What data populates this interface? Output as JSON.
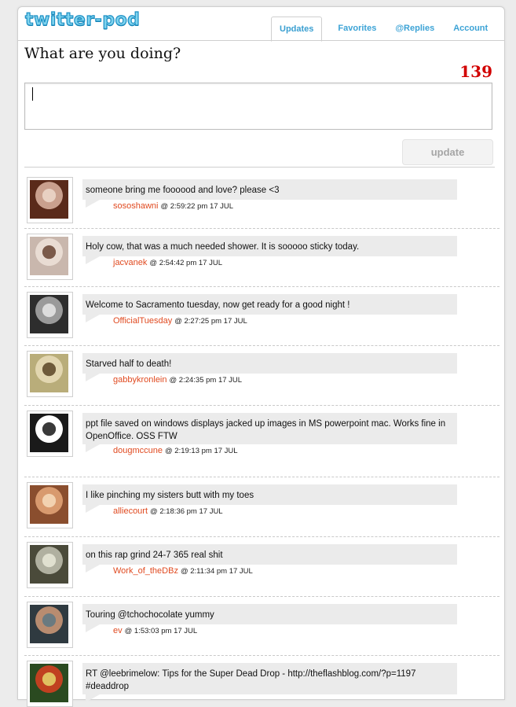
{
  "app": {
    "logo": "twitter-pod"
  },
  "tabs": [
    {
      "label": "Updates",
      "active": true
    },
    {
      "label": "Favorites",
      "active": false
    },
    {
      "label": "@Replies",
      "active": false
    },
    {
      "label": "Account",
      "active": false
    }
  ],
  "composer": {
    "prompt": "What are you doing?",
    "remaining": "139",
    "value": "",
    "update_label": "update"
  },
  "colors": {
    "accent": "#3ca3d6",
    "counter": "#d20000",
    "username": "#e04a20"
  },
  "tweets": [
    {
      "text": "someone bring me foooood and love? please <3",
      "user": "sososhawni",
      "time": "@ 2:59:22 pm 17 JUL",
      "avatar": "user-photo"
    },
    {
      "text": "Holy cow, that was a much needed shower. It is sooooo sticky today.",
      "user": "jacvanek",
      "time": "@ 2:54:42 pm 17 JUL",
      "avatar": "user-photo"
    },
    {
      "text": "Welcome to Sacramento tuesday, now get ready for a good night !",
      "user": "OfficialTuesday",
      "time": "@ 2:27:25 pm 17 JUL",
      "avatar": "user-photo"
    },
    {
      "text": "Starved half to death!",
      "user": "gabbykronlein",
      "time": "@ 2:24:35 pm 17 JUL",
      "avatar": "user-photo"
    },
    {
      "text": "ppt file saved on windows displays jacked up images in MS powerpoint mac. Works fine in OpenOffice. OSS FTW",
      "user": "dougmccune",
      "time": "@ 2:19:13 pm 17 JUL",
      "avatar": "user-photo"
    },
    {
      "text": "I like pinching my sisters butt with my toes",
      "user": "alliecourt",
      "time": "@ 2:18:36 pm 17 JUL",
      "avatar": "user-photo"
    },
    {
      "text": "on this rap grind 24-7 365 real shit",
      "user": "Work_of_theDBz",
      "time": "@ 2:11:34 pm 17 JUL",
      "avatar": "user-photo"
    },
    {
      "text": "Touring @tchochocolate yummy",
      "user": "ev",
      "time": "@ 1:53:03 pm 17 JUL",
      "avatar": "user-photo"
    },
    {
      "text": "RT @leebrimelow: Tips for the Super Dead Drop - http://theflashblog.com/?p=1197 #deaddrop",
      "user": "",
      "time": "",
      "avatar": "user-photo"
    }
  ]
}
